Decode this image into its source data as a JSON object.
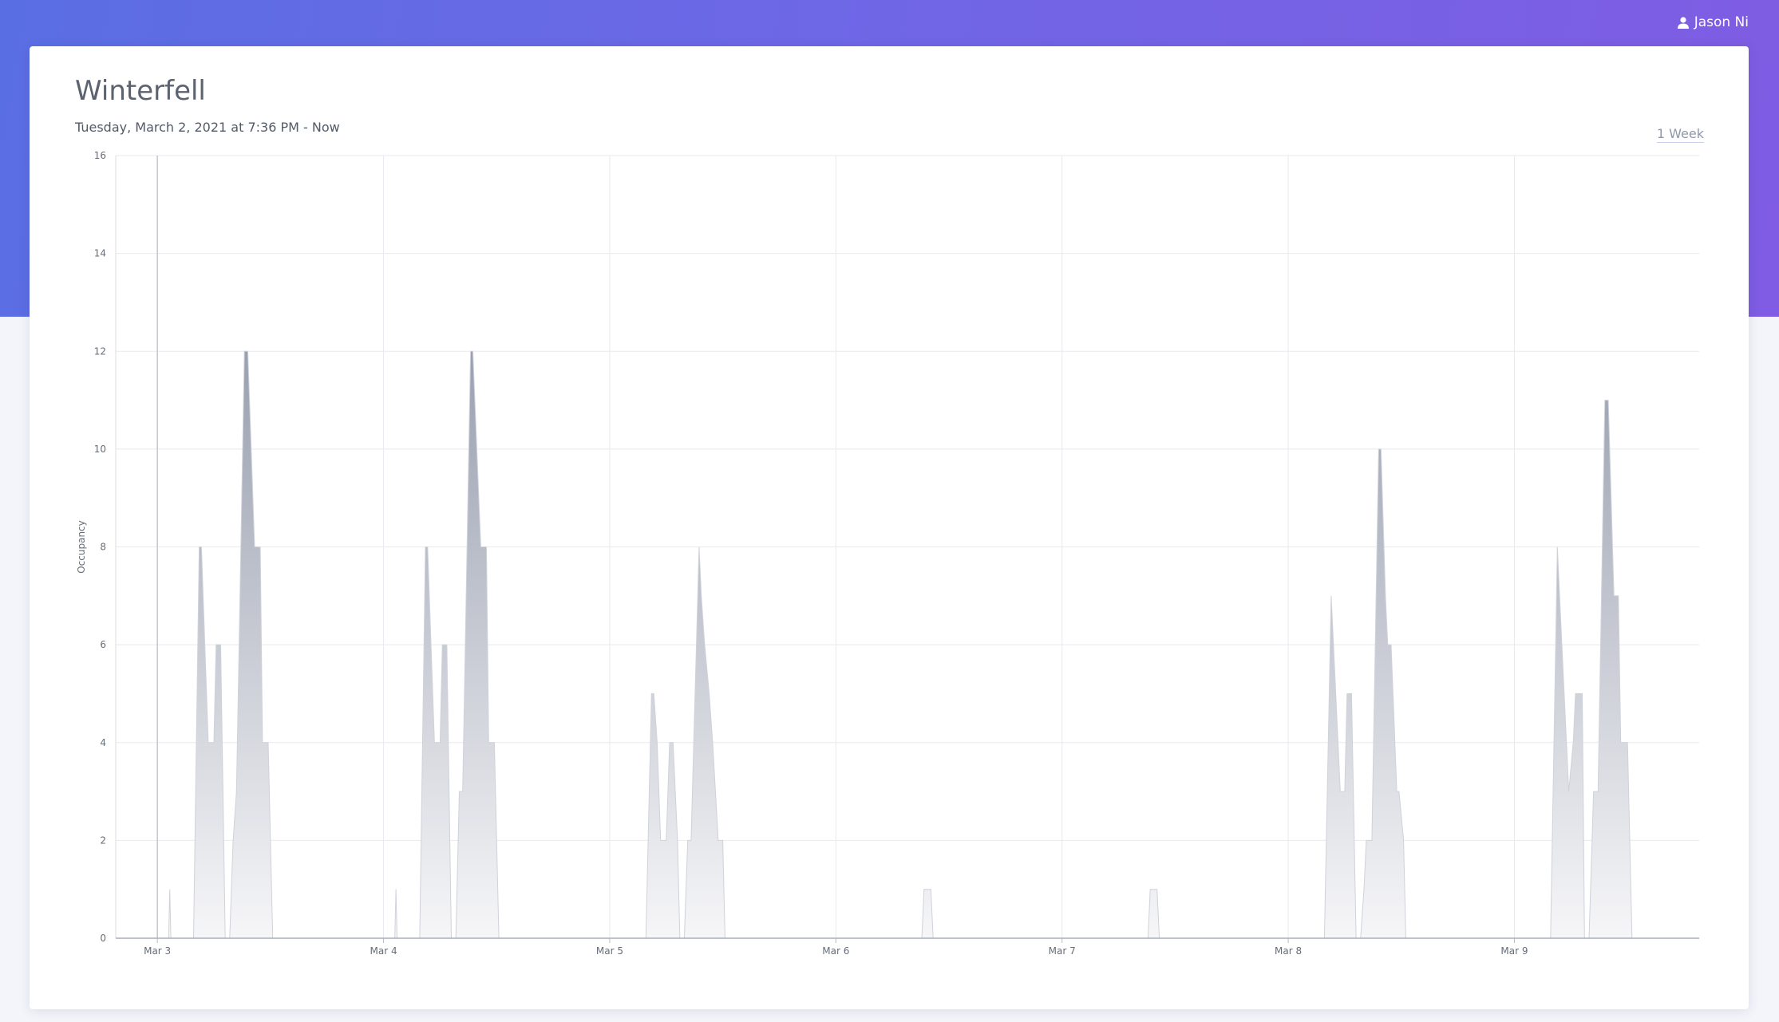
{
  "header": {
    "user_name": "Jason Ni",
    "user_icon": "person-icon"
  },
  "page": {
    "title": "Winterfell",
    "subtitle": "Tuesday, March 2, 2021 at 7:36 PM - Now",
    "range_label": "1 Week"
  },
  "colors": {
    "header_start": "#5a6ee3",
    "header_end": "#7f5ce3",
    "area_top": "#9aa0b0",
    "area_bottom": "#f6f6f8",
    "area_stroke": "#cfd2da",
    "grid": "#e9e9ef"
  },
  "chart_data": {
    "type": "area",
    "title": "",
    "xlabel": "",
    "ylabel": "Occupancy",
    "x_unit": "days since Mar 3 00:00",
    "xlim": [
      -0.184,
      6.817
    ],
    "ylim": [
      0,
      16
    ],
    "yticks": [
      0,
      2,
      4,
      6,
      8,
      10,
      12,
      14,
      16
    ],
    "xticks": [
      {
        "x": 0,
        "label": "Mar 3"
      },
      {
        "x": 1,
        "label": "Mar 4"
      },
      {
        "x": 2,
        "label": "Mar 5"
      },
      {
        "x": 3,
        "label": "Mar 6"
      },
      {
        "x": 4,
        "label": "Mar 7"
      },
      {
        "x": 5,
        "label": "Mar 8"
      },
      {
        "x": 6,
        "label": "Mar 9"
      }
    ],
    "grid": true,
    "legend": "none",
    "series": [
      {
        "name": "Occupancy",
        "points": [
          [
            -0.184,
            0
          ],
          [
            0.05,
            0
          ],
          [
            0.055,
            1
          ],
          [
            0.06,
            0
          ],
          [
            0.16,
            0
          ],
          [
            0.185,
            8
          ],
          [
            0.195,
            8
          ],
          [
            0.225,
            4
          ],
          [
            0.25,
            4
          ],
          [
            0.26,
            6
          ],
          [
            0.28,
            6
          ],
          [
            0.3,
            0
          ],
          [
            0.32,
            0
          ],
          [
            0.335,
            2
          ],
          [
            0.35,
            3
          ],
          [
            0.385,
            12
          ],
          [
            0.4,
            12
          ],
          [
            0.43,
            8
          ],
          [
            0.455,
            8
          ],
          [
            0.465,
            4
          ],
          [
            0.49,
            4
          ],
          [
            0.51,
            0
          ],
          [
            1.05,
            0
          ],
          [
            1.055,
            1
          ],
          [
            1.06,
            0
          ],
          [
            1.16,
            0
          ],
          [
            1.185,
            8
          ],
          [
            1.195,
            8
          ],
          [
            1.225,
            4
          ],
          [
            1.25,
            4
          ],
          [
            1.26,
            6
          ],
          [
            1.28,
            6
          ],
          [
            1.3,
            0
          ],
          [
            1.32,
            0
          ],
          [
            1.335,
            3
          ],
          [
            1.35,
            3
          ],
          [
            1.385,
            12
          ],
          [
            1.395,
            12
          ],
          [
            1.43,
            8
          ],
          [
            1.455,
            8
          ],
          [
            1.465,
            4
          ],
          [
            1.49,
            4
          ],
          [
            1.51,
            0
          ],
          [
            2.16,
            0
          ],
          [
            2.185,
            5
          ],
          [
            2.195,
            5
          ],
          [
            2.21,
            4
          ],
          [
            2.225,
            2
          ],
          [
            2.25,
            2
          ],
          [
            2.265,
            4
          ],
          [
            2.28,
            4
          ],
          [
            2.3,
            2
          ],
          [
            2.31,
            0
          ],
          [
            2.33,
            0
          ],
          [
            2.345,
            2
          ],
          [
            2.36,
            2
          ],
          [
            2.395,
            8
          ],
          [
            2.405,
            7
          ],
          [
            2.42,
            6
          ],
          [
            2.44,
            5
          ],
          [
            2.455,
            4
          ],
          [
            2.48,
            2
          ],
          [
            2.5,
            2
          ],
          [
            2.51,
            0
          ],
          [
            3.38,
            0
          ],
          [
            3.39,
            1
          ],
          [
            3.42,
            1
          ],
          [
            3.43,
            0
          ],
          [
            4.38,
            0
          ],
          [
            4.39,
            1
          ],
          [
            4.42,
            1
          ],
          [
            4.43,
            0
          ],
          [
            5.16,
            0
          ],
          [
            5.19,
            7
          ],
          [
            5.2,
            6
          ],
          [
            5.23,
            3
          ],
          [
            5.25,
            3
          ],
          [
            5.26,
            5
          ],
          [
            5.28,
            5
          ],
          [
            5.3,
            0
          ],
          [
            5.32,
            0
          ],
          [
            5.335,
            1
          ],
          [
            5.345,
            2
          ],
          [
            5.37,
            2
          ],
          [
            5.4,
            10
          ],
          [
            5.41,
            10
          ],
          [
            5.43,
            7
          ],
          [
            5.44,
            6
          ],
          [
            5.455,
            6
          ],
          [
            5.48,
            3
          ],
          [
            5.49,
            3
          ],
          [
            5.51,
            2
          ],
          [
            5.52,
            0
          ],
          [
            6.16,
            0
          ],
          [
            6.19,
            8
          ],
          [
            6.2,
            7
          ],
          [
            6.23,
            4
          ],
          [
            6.24,
            3
          ],
          [
            6.26,
            4
          ],
          [
            6.27,
            5
          ],
          [
            6.3,
            5
          ],
          [
            6.31,
            0
          ],
          [
            6.33,
            0
          ],
          [
            6.35,
            3
          ],
          [
            6.37,
            3
          ],
          [
            6.4,
            11
          ],
          [
            6.415,
            11
          ],
          [
            6.44,
            7
          ],
          [
            6.46,
            7
          ],
          [
            6.47,
            4
          ],
          [
            6.5,
            4
          ],
          [
            6.52,
            0
          ],
          [
            6.817,
            0
          ]
        ]
      }
    ]
  }
}
